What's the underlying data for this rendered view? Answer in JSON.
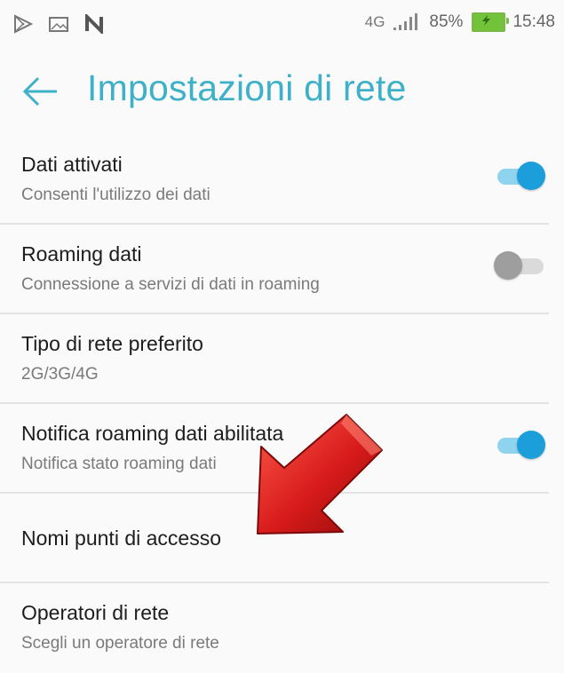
{
  "statusbar": {
    "left_icons": [
      "play-store-icon",
      "image-icon",
      "nfc-icon"
    ],
    "network": "4G",
    "battery": "85%",
    "time": "15:48"
  },
  "appbar": {
    "title": "Impostazioni di rete"
  },
  "settings": [
    {
      "title": "Dati attivati",
      "subtitle": "Consenti l'utilizzo dei dati",
      "toggle": "on"
    },
    {
      "title": "Roaming dati",
      "subtitle": "Connessione a servizi di dati in roaming",
      "toggle": "off"
    },
    {
      "title": "Tipo di rete preferito",
      "subtitle": "2G/3G/4G"
    },
    {
      "title": "Notifica roaming dati abilitata",
      "subtitle": "Notifica stato roaming dati",
      "toggle": "on"
    },
    {
      "title": "Nomi punti di accesso"
    },
    {
      "title": "Operatori di rete",
      "subtitle": "Scegli un operatore di rete"
    }
  ],
  "colors": {
    "accent": "#3eb1c8",
    "toggle_on": "#1c9edb",
    "arrow": "#d61a1a"
  }
}
